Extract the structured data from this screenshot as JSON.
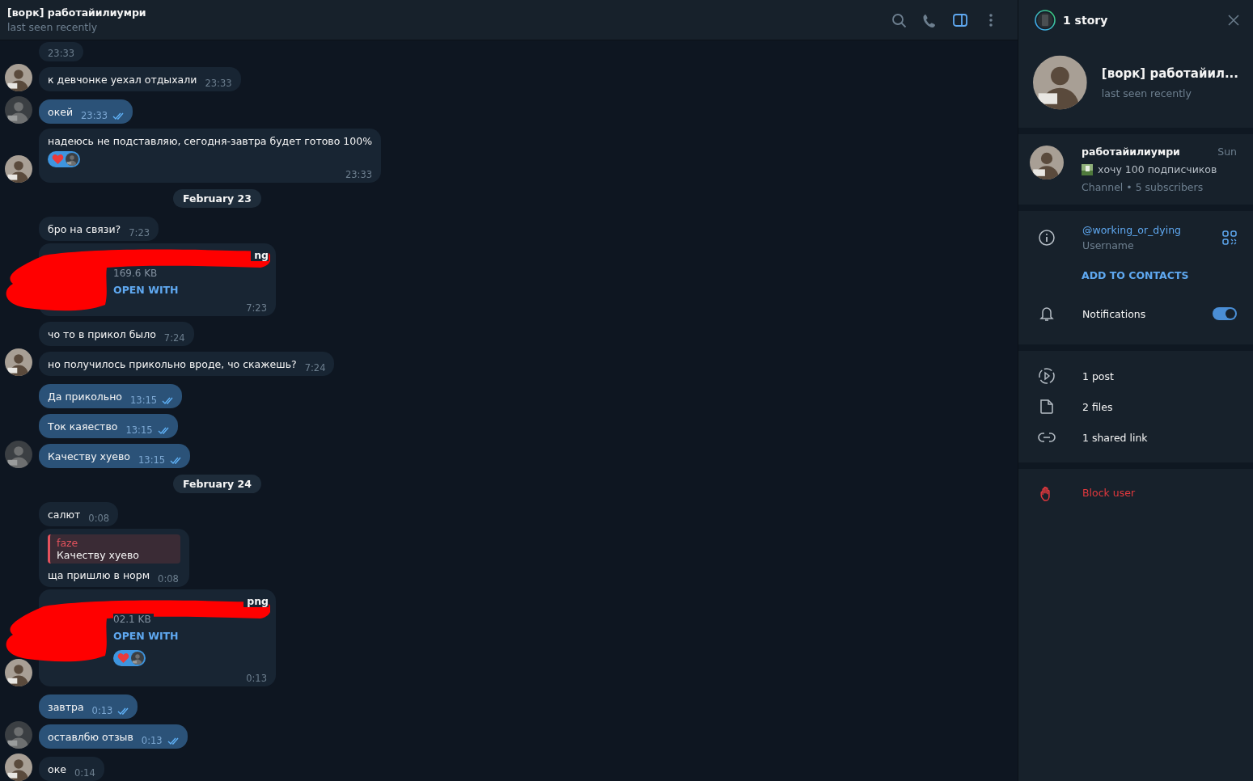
{
  "header": {
    "title": "[ворк] работайилиумри",
    "status": "last seen recently"
  },
  "toolbar": [
    {
      "kind": "search",
      "active": false
    },
    {
      "kind": "call",
      "active": false
    },
    {
      "kind": "sidebar",
      "active": true
    },
    {
      "kind": "more",
      "active": false
    }
  ],
  "messages": [
    {
      "kind": "text",
      "outgoing": false,
      "time": "23:33"
    },
    {
      "kind": "text",
      "outgoing": false,
      "avatar": true,
      "text": "к девчонке уехал отдыхали",
      "time": "23:33"
    },
    {
      "kind": "text",
      "outgoing": true,
      "avatar": true,
      "text": "окей",
      "time": "23:33",
      "read": true
    },
    {
      "kind": "text",
      "outgoing": false,
      "avatar": true,
      "text": "надеюсь не подставляю, сегодня-завтра будет готово 100%",
      "time": "23:33",
      "reacted": true
    },
    {
      "kind": "date",
      "text": "February 23"
    },
    {
      "kind": "text",
      "outgoing": false,
      "text": "бро на связи?",
      "time": "7:23"
    },
    {
      "kind": "file",
      "outgoing": false,
      "name": "ng",
      "size": "169.6 KB",
      "action": "OPEN WITH",
      "time": "7:23",
      "redacted": true
    },
    {
      "kind": "text",
      "outgoing": false,
      "text": "чо то в прикол было",
      "time": "7:24"
    },
    {
      "kind": "text",
      "outgoing": false,
      "avatar": true,
      "text": "но получилось прикольно вроде, чо скажешь?",
      "time": "7:24"
    },
    {
      "kind": "text",
      "outgoing": true,
      "text": "Да прикольно",
      "time": "13:15",
      "read": true
    },
    {
      "kind": "text",
      "outgoing": true,
      "text": "Ток каяество",
      "time": "13:15",
      "read": true
    },
    {
      "kind": "text",
      "outgoing": true,
      "avatar": true,
      "text": "Качеству хуево",
      "time": "13:15",
      "read": true
    },
    {
      "kind": "date",
      "text": "February 24"
    },
    {
      "kind": "text",
      "outgoing": false,
      "text": "салют",
      "time": "0:08"
    },
    {
      "kind": "reply",
      "outgoing": false,
      "reply_author": "faze",
      "reply_text": "Качеству хуево",
      "text": "ща пришлю в норм",
      "time": "0:08"
    },
    {
      "kind": "file",
      "outgoing": false,
      "avatar": true,
      "name": "png",
      "size": "02.1 KB",
      "action": "OPEN WITH",
      "time": "0:13",
      "redacted": true,
      "reacted": true
    },
    {
      "kind": "text",
      "outgoing": true,
      "text": "завтра",
      "time": "0:13",
      "read": true
    },
    {
      "kind": "text",
      "outgoing": true,
      "avatar": true,
      "text": "оставлбю отзыв",
      "time": "0:13",
      "read": true
    },
    {
      "kind": "text",
      "outgoing": false,
      "avatar": true,
      "text": "оке",
      "time": "0:14"
    }
  ],
  "profile_panel": {
    "story_label": "1 story",
    "name": "[ворк] работайил...",
    "status": "last seen recently",
    "channel": {
      "name": "работайилиумри",
      "day": "Sun",
      "snippet": "хочу 100 подписчиков",
      "meta": "Channel • 5 subscribers"
    },
    "username": {
      "value": "@working_or_dying",
      "label": "Username"
    },
    "add_contact": "ADD TO CONTACTS",
    "notifications": {
      "label": "Notifications",
      "on": true
    },
    "media": [
      {
        "kind": "posts",
        "label": "1 post"
      },
      {
        "kind": "files",
        "label": "2 files"
      },
      {
        "kind": "links",
        "label": "1 shared link"
      }
    ],
    "block": "Block user"
  }
}
